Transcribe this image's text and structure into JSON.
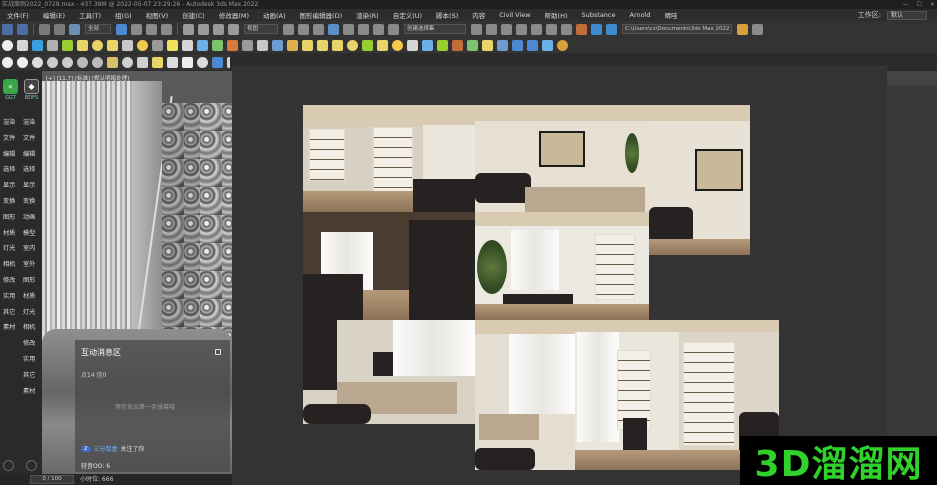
{
  "titlebar": {
    "title": "实战案例2022_0729.max - 437.38M @ 2022-05-07 23:29:26 - Autodesk 3ds Max 2022"
  },
  "menu": {
    "items": [
      "文件(F)",
      "编辑(E)",
      "工具(T)",
      "组(G)",
      "视图(V)",
      "创建(C)",
      "修改器(M)",
      "动画(A)",
      "图形编辑器(D)",
      "渲染(R)",
      "Civil View",
      "自定义(U)",
      "脚本(S)",
      "内容",
      "Civil View",
      "帮助(H)",
      "Substance",
      "Arnold",
      "晴哇"
    ],
    "workspace_label": "工作区:",
    "workspace_value": "默认"
  },
  "toolbar": {
    "filter_select": "全部",
    "view_select": "视图",
    "selection_set": "创建选择集",
    "path_field": "C:\\Users\\cs\\Documents\\3ds Max 2022"
  },
  "left_panel": {
    "logo_left": "GGT",
    "logo_right": "BDFS",
    "categories_left": [
      "渲染",
      "文件",
      "编辑",
      "选择",
      "显示",
      "变换",
      "图形",
      "材质",
      "灯光",
      "相机",
      "修改",
      "实用",
      "其它",
      "素材"
    ],
    "categories_right": [
      "渲染",
      "文件",
      "编辑",
      "选择",
      "显示",
      "变换",
      "动画",
      "模型",
      "室内",
      "室外",
      "图形",
      "材质",
      "灯光",
      "相机",
      "修改",
      "实用",
      "其它",
      "素材"
    ]
  },
  "viewport": {
    "label": "[+] [11.7] [标准] [默认明暗处理]"
  },
  "chat": {
    "title": "互动消息区",
    "row1": "点14   信0",
    "ghost_text": "等你发出第一条弹幕哦",
    "badge_count": "2",
    "user": "三分鼠盒",
    "action": "关注了你",
    "gift": "轻音OO: 6"
  },
  "status": {
    "progress": "0 / 100",
    "right_text": "小时位: 666"
  },
  "watermark": {
    "text": "3D溜溜网"
  },
  "colors": {
    "accent_green": "#2fd12a",
    "ggt_logo": "#3aa64a",
    "toolbar_bg": "#333333",
    "chat_badge": "#3d6ecf"
  }
}
